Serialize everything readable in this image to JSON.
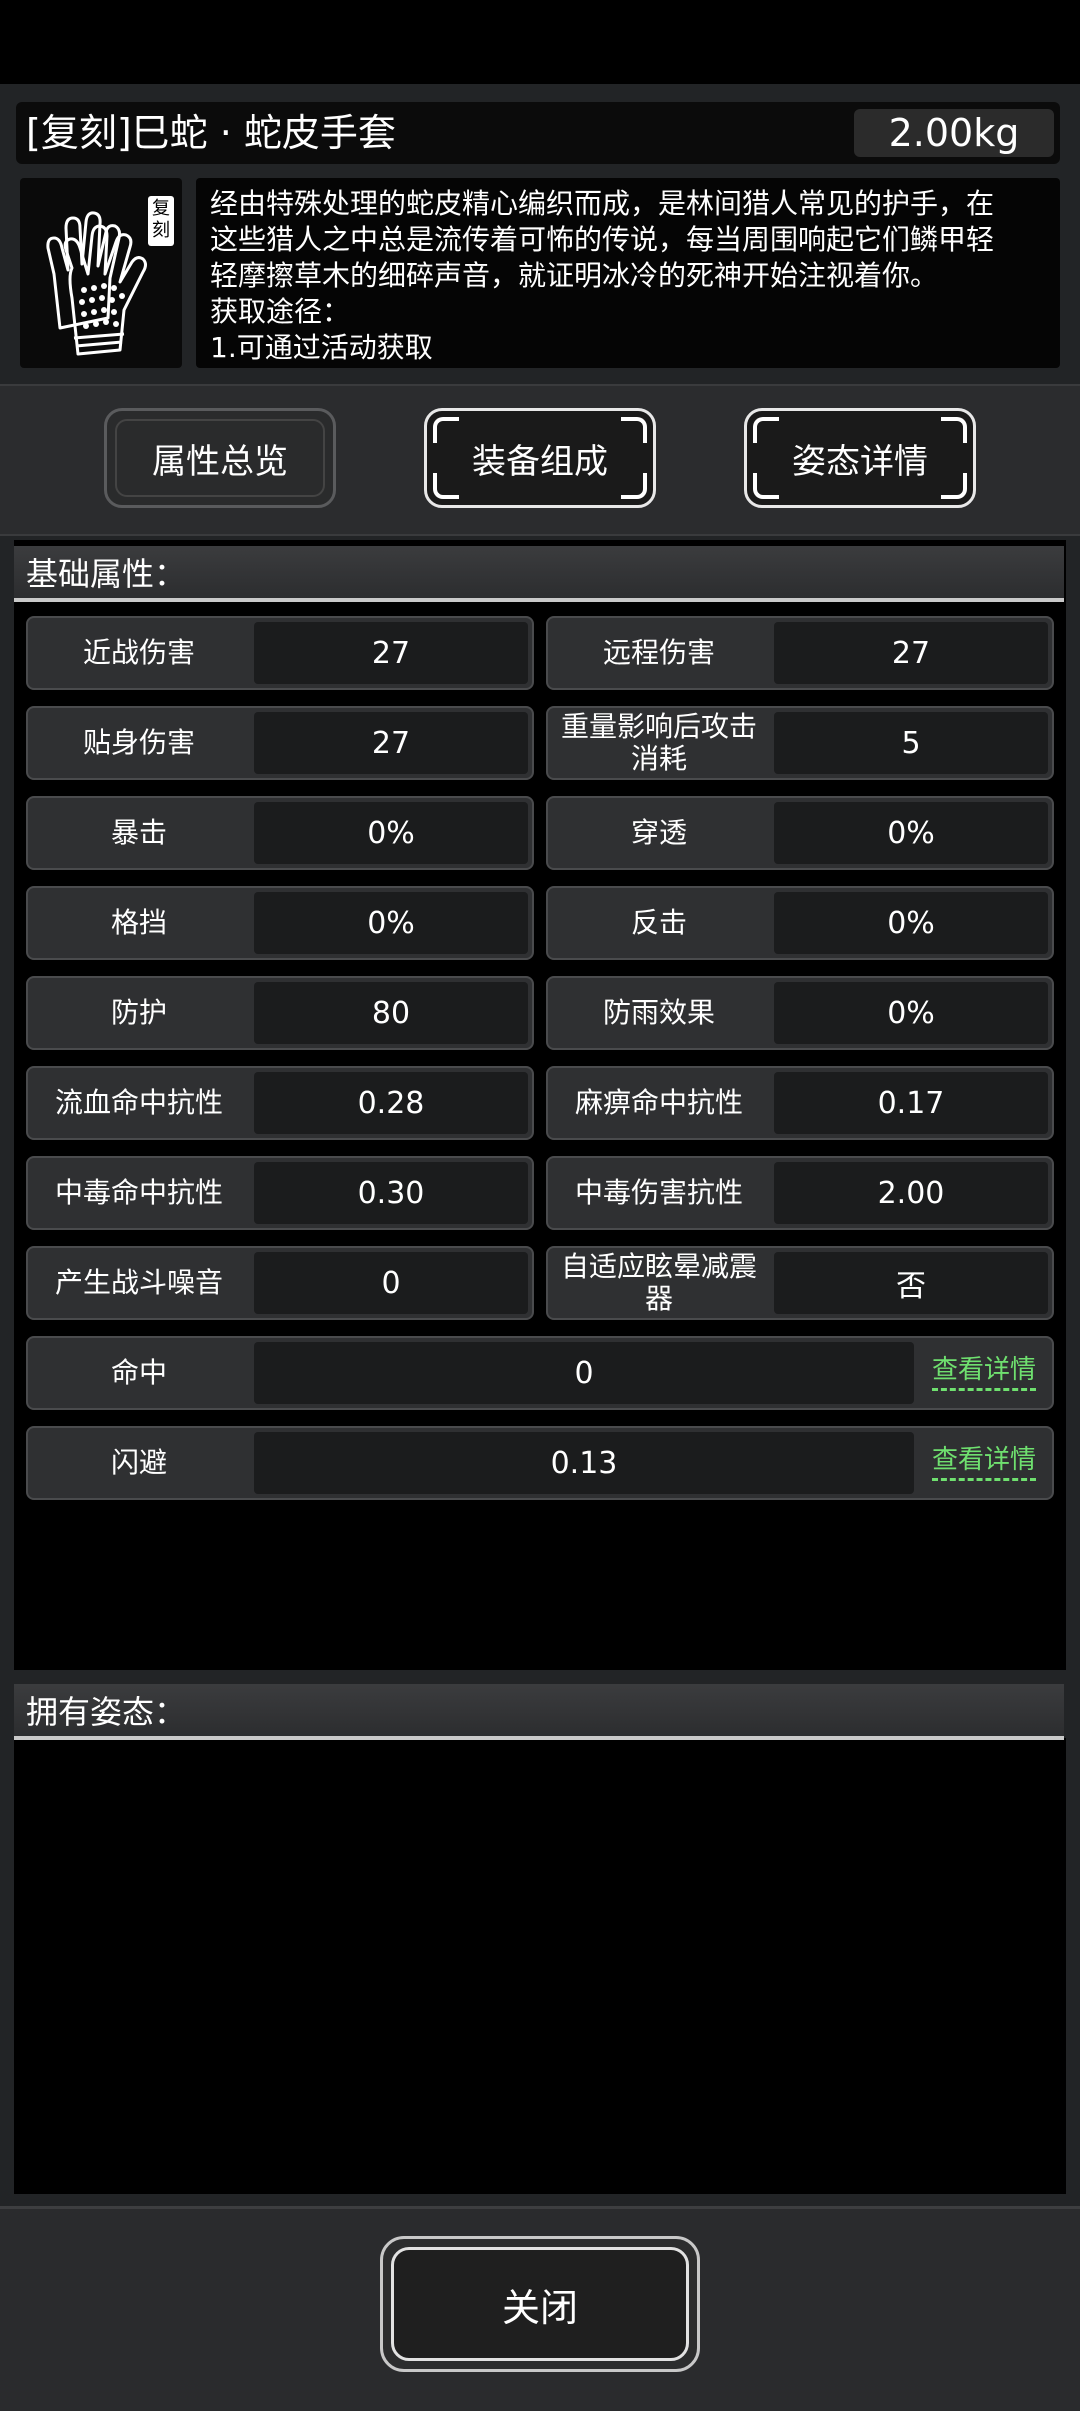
{
  "header": {
    "title": "[复刻]巳蛇 · 蛇皮手套",
    "weight": "2.00kg"
  },
  "item": {
    "badge": "复刻",
    "icon": "gloves-icon",
    "description_lines": [
      "经由特殊处理的蛇皮精心编织而成，是林间猎人常见的护手，在",
      "这些猎人之中总是流传着可怖的传说，每当周围响起它们鳞甲轻",
      "轻摩擦草木的细碎声音，就证明冰冷的死神开始注视着你。",
      "获取途径：",
      "1.可通过活动获取"
    ]
  },
  "tabs": [
    {
      "label": "属性总览",
      "active": false
    },
    {
      "label": "装备组成",
      "active": true
    },
    {
      "label": "姿态详情",
      "active": true
    }
  ],
  "base_attrs": {
    "title": "基础属性：",
    "pairs": [
      [
        {
          "label": "近战伤害",
          "value": "27"
        },
        {
          "label": "远程伤害",
          "value": "27"
        }
      ],
      [
        {
          "label": "贴身伤害",
          "value": "27"
        },
        {
          "label": "重量影响后攻击消耗",
          "value": "5"
        }
      ],
      [
        {
          "label": "暴击",
          "value": "0%"
        },
        {
          "label": "穿透",
          "value": "0%"
        }
      ],
      [
        {
          "label": "格挡",
          "value": "0%"
        },
        {
          "label": "反击",
          "value": "0%"
        }
      ],
      [
        {
          "label": "防护",
          "value": "80"
        },
        {
          "label": "防雨效果",
          "value": "0%"
        }
      ],
      [
        {
          "label": "流血命中抗性",
          "value": "0.28"
        },
        {
          "label": "麻痹命中抗性",
          "value": "0.17"
        }
      ],
      [
        {
          "label": "中毒命中抗性",
          "value": "0.30"
        },
        {
          "label": "中毒伤害抗性",
          "value": "2.00"
        }
      ],
      [
        {
          "label": "产生战斗噪音",
          "value": "0"
        },
        {
          "label": "自适应眩晕减震器",
          "value": "否"
        }
      ]
    ],
    "wide_rows": [
      {
        "label": "命中",
        "value": "0",
        "link": "查看详情"
      },
      {
        "label": "闪避",
        "value": "0.13",
        "link": "查看详情"
      }
    ]
  },
  "postures": {
    "title": "拥有姿态："
  },
  "footer": {
    "close_label": "关闭"
  },
  "colors": {
    "link": "#6fe06f",
    "panel": "#222426",
    "accent_border": "#e8e8e8"
  }
}
